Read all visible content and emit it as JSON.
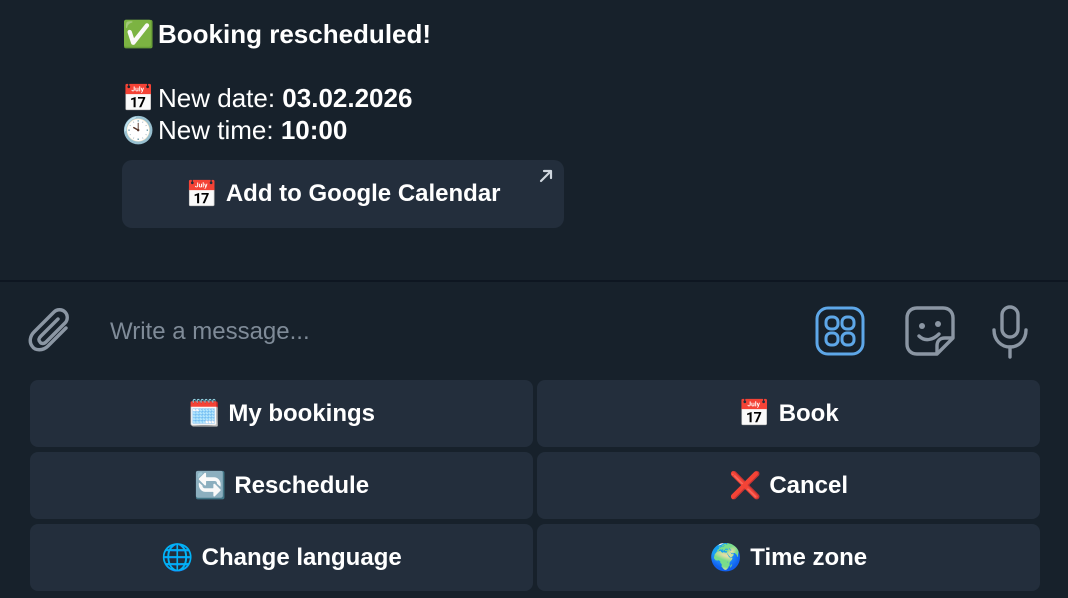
{
  "message": {
    "headline_emoji": "✅",
    "headline": "Booking rescheduled!",
    "date_emoji": "📅",
    "date_label": "New date: ",
    "date_value": "03.02.2026",
    "time_emoji": "🕙",
    "time_label": "New time: ",
    "time_value": "10:00",
    "inline_button": {
      "emoji": "📅",
      "label": "Add to Google Calendar",
      "icon": "external-link-arrow-icon"
    }
  },
  "composer": {
    "placeholder": "Write a message...",
    "icons": [
      "paperclip-icon",
      "bot-menu-icon",
      "sticker-icon",
      "microphone-icon"
    ],
    "accent_color": "#5ea7e8"
  },
  "keyboard": {
    "buttons": [
      {
        "emoji": "🗓️",
        "label": "My bookings"
      },
      {
        "emoji": "📅",
        "label": "Book"
      },
      {
        "emoji": "🔄",
        "label": "Reschedule"
      },
      {
        "emoji": "❌",
        "label": "Cancel"
      },
      {
        "emoji": "🌐",
        "label": "Change language"
      },
      {
        "emoji": "🌍",
        "label": "Time zone"
      }
    ]
  }
}
